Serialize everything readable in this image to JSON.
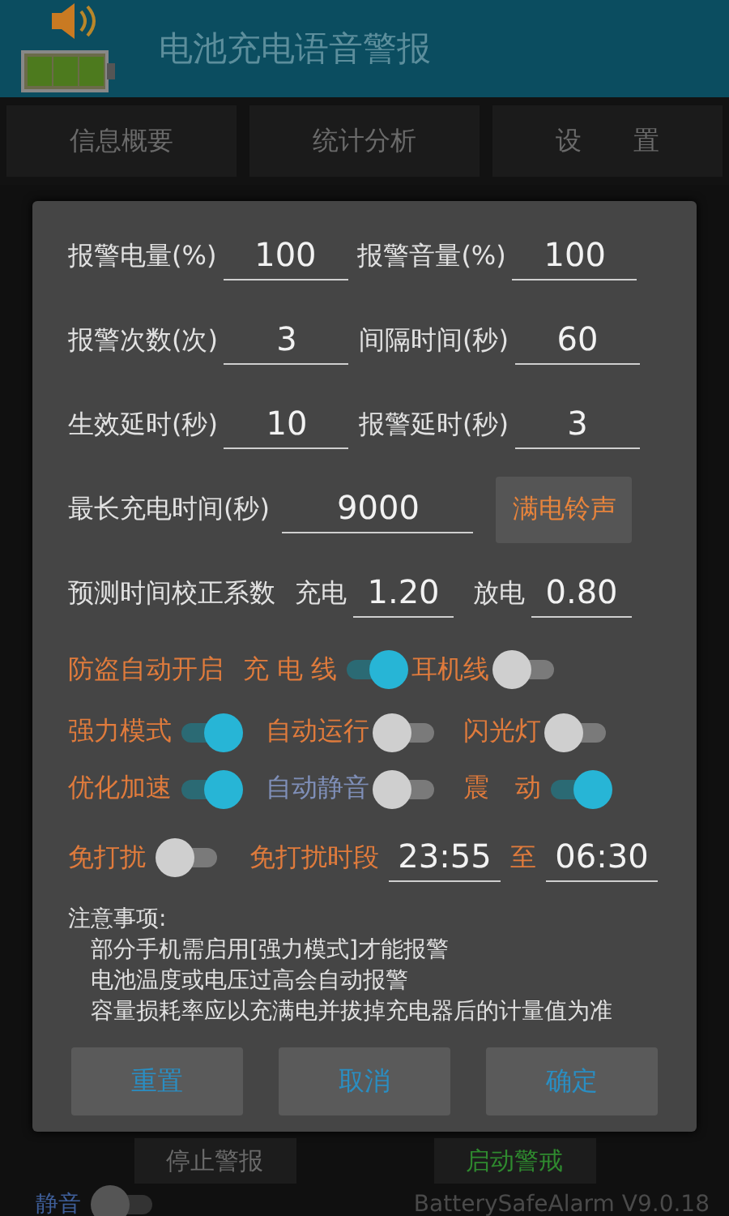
{
  "header": {
    "title": "电池充电语音警报"
  },
  "tabs": [
    {
      "label": "信息概要"
    },
    {
      "label": "统计分析"
    },
    {
      "label": "设　　置"
    }
  ],
  "dialog": {
    "field_rows": [
      [
        {
          "label": "报警电量(%)",
          "value": "100"
        },
        {
          "label": "报警音量(%)",
          "value": "100"
        }
      ],
      [
        {
          "label": "报警次数(次)",
          "value": "3"
        },
        {
          "label": "间隔时间(秒)",
          "value": "60"
        }
      ],
      [
        {
          "label": "生效延时(秒)",
          "value": "10"
        },
        {
          "label": "报警延时(秒)",
          "value": "3"
        }
      ]
    ],
    "max_charge": {
      "label": "最长充电时间(秒)",
      "value": "9000"
    },
    "ringtone_button": "满电铃声",
    "coefficient": {
      "label": "预测时间校正系数",
      "charge_label": "充电",
      "charge_value": "1.20",
      "discharge_label": "放电",
      "discharge_value": "0.80"
    },
    "antitheft": {
      "label": "防盗自动开启",
      "switches": [
        {
          "label": "充 电 线",
          "on": true
        },
        {
          "label": "耳机线",
          "on": false
        }
      ]
    },
    "switch_rows": [
      [
        {
          "label": "强力模式",
          "on": true,
          "color": "#e07b3c"
        },
        {
          "label": "自动运行",
          "on": false,
          "color": "#e07b3c"
        },
        {
          "label": "闪光灯",
          "on": false,
          "color": "#e07b3c"
        }
      ],
      [
        {
          "label": "优化加速",
          "on": true,
          "color": "#e07b3c"
        },
        {
          "label": "自动静音",
          "on": false,
          "color": "#7f8fb8"
        },
        {
          "label": "震　动",
          "on": true,
          "color": "#e07b3c"
        }
      ]
    ],
    "dnd": {
      "label": "免打扰",
      "on": false,
      "period_label": "免打扰时段",
      "from": "23:55",
      "to_label": "至",
      "to": "06:30"
    },
    "notes": {
      "title": "注意事项:",
      "lines": [
        "部分手机需启用[强力模式]才能报警",
        "电池温度或电压过高会自动报警",
        "容量损耗率应以充满电并拔掉充电器后的计量值为准"
      ]
    },
    "buttons": [
      "重置",
      "取消",
      "确定"
    ]
  },
  "background": {
    "buttons": [
      {
        "label": "停止警报",
        "color": "#6a6a6a"
      },
      {
        "label": "启动警戒",
        "color": "#2f8a2f"
      }
    ],
    "mute": {
      "label": "静音",
      "on": false
    },
    "version": "BatterySafeAlarm V9.0.18"
  }
}
